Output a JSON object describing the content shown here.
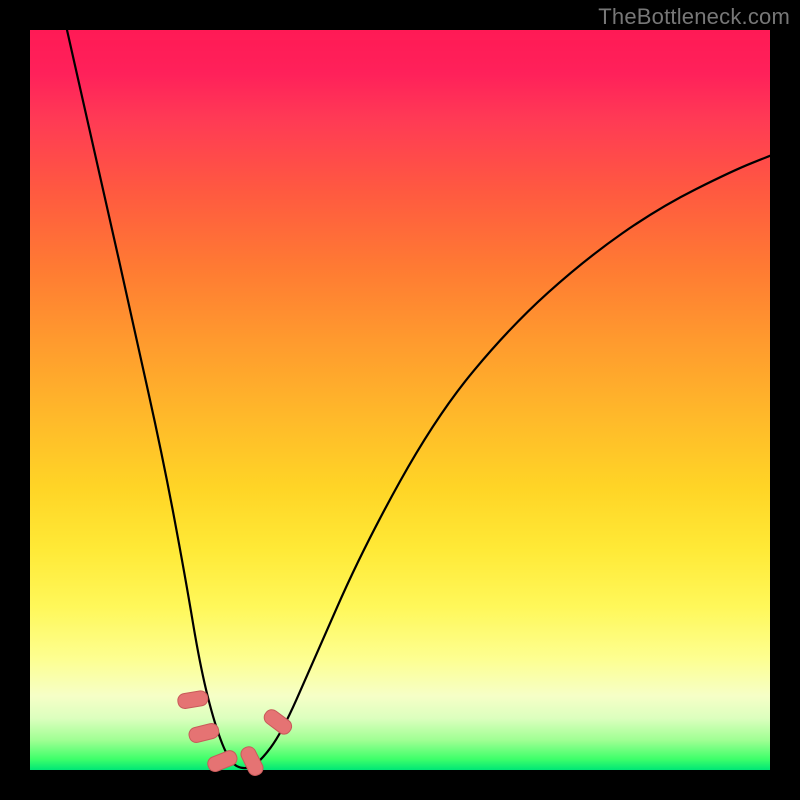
{
  "watermark": "TheBottleneck.com",
  "chart_data": {
    "type": "line",
    "title": "",
    "xlabel": "",
    "ylabel": "",
    "xlim": [
      0,
      100
    ],
    "ylim": [
      0,
      100
    ],
    "grid": false,
    "legend": false,
    "series": [
      {
        "name": "bottleneck-curve",
        "x": [
          5,
          10,
          14,
          18,
          21,
          23,
          25,
          27,
          29,
          31,
          34,
          38,
          45,
          55,
          65,
          75,
          85,
          95,
          100
        ],
        "y": [
          100,
          78,
          60,
          42,
          26,
          14,
          6,
          1,
          0,
          1,
          5,
          14,
          30,
          48,
          60,
          69,
          76,
          81,
          83
        ]
      }
    ],
    "markers": [
      {
        "name": "m1",
        "x": 22.0,
        "y": 9.5
      },
      {
        "name": "m2",
        "x": 23.5,
        "y": 5.0
      },
      {
        "name": "m3",
        "x": 26.0,
        "y": 1.2
      },
      {
        "name": "m4",
        "x": 30.0,
        "y": 1.2
      },
      {
        "name": "m5",
        "x": 33.5,
        "y": 6.5
      }
    ],
    "colors": {
      "curve": "#000000",
      "marker_fill": "#e57373",
      "marker_stroke": "#c85a5a",
      "gradient_top": "#ff1a55",
      "gradient_bottom": "#00e676",
      "frame": "#000000"
    }
  }
}
